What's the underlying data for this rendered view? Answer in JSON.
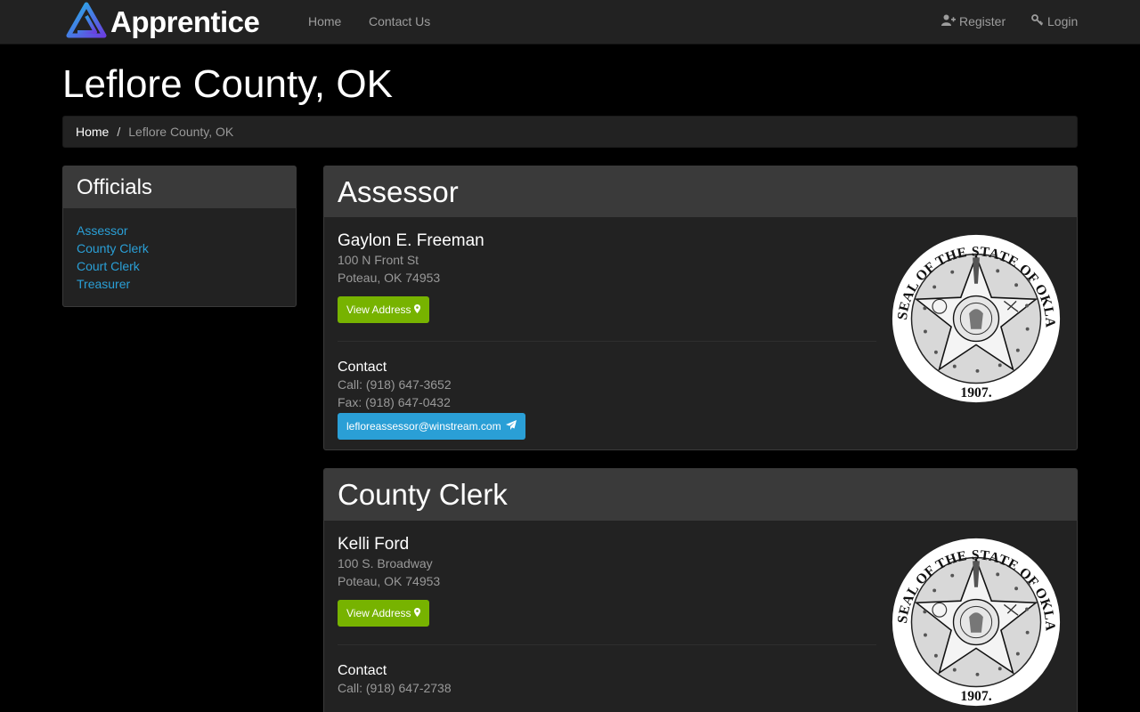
{
  "navbar": {
    "brand": "Apprentice",
    "links": [
      {
        "label": "Home"
      },
      {
        "label": "Contact Us"
      }
    ],
    "register": "Register",
    "login": "Login"
  },
  "page": {
    "title": "Leflore County, OK"
  },
  "breadcrumb": {
    "home": "Home",
    "separator": "/",
    "current": "Leflore County, OK"
  },
  "sidebar": {
    "title": "Officials",
    "items": [
      {
        "label": "Assessor"
      },
      {
        "label": "County Clerk"
      },
      {
        "label": "Court Clerk"
      },
      {
        "label": "Treasurer"
      }
    ]
  },
  "offices": [
    {
      "title": "Assessor",
      "name": "Gaylon E. Freeman",
      "address1": "100 N Front St",
      "address2": "Poteau, OK 74953",
      "view_address": "View Address",
      "contact_label": "Contact",
      "call": "Call: (918) 647-3652",
      "fax": "Fax: (918) 647-0432",
      "email": "lefloreassessor@winstream.com"
    },
    {
      "title": "County Clerk",
      "name": "Kelli Ford",
      "address1": "100 S. Broadway",
      "address2": "Poteau, OK 74953",
      "view_address": "View Address",
      "contact_label": "Contact",
      "call": "Call: (918) 647-2738"
    }
  ],
  "seal": {
    "text": "GREAT SEAL OF THE STATE OF OKLAHOMA",
    "year": "1907."
  },
  "colors": {
    "link": "#2a9fd6",
    "success": "#77b300",
    "info": "#2a9fd6",
    "navbar": "#222222",
    "panel_heading": "#3a3a3a"
  },
  "icons": {
    "brand": "apprentice-logo-icon",
    "register": "user-plus-icon",
    "login": "key-icon",
    "view_address": "map-marker-icon",
    "email": "paper-plane-icon",
    "seal": "oklahoma-seal-icon"
  }
}
